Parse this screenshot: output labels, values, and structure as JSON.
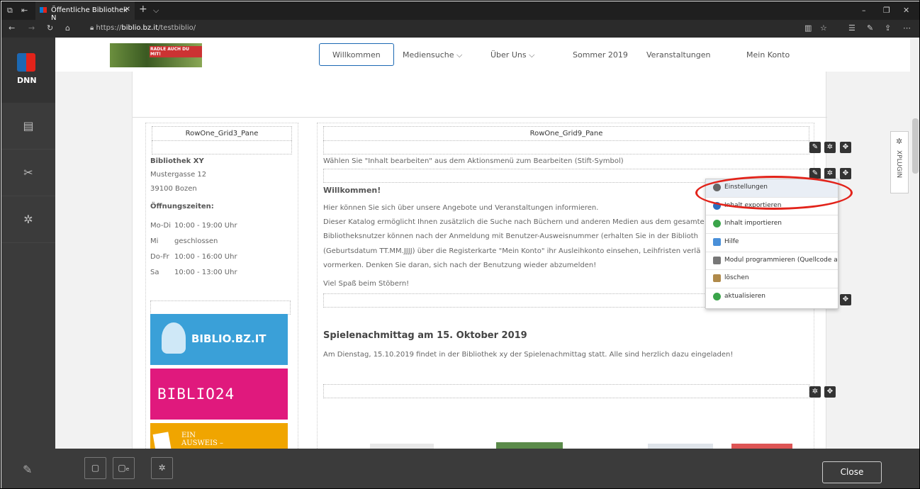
{
  "browser": {
    "tab_title": "Öffentliche Bibliothek N",
    "url_prefix": "https://",
    "url_host": "biblio.bz.it",
    "url_path": "/testbiblio/"
  },
  "dnn": {
    "logo_text": "DNN"
  },
  "nav": [
    "Willkommen",
    "Mediensuche ⌵",
    "Über Uns ⌵",
    "Sommer 2019",
    "Veranstaltungen",
    "Mein Konto"
  ],
  "banner": {
    "text": "RADLE AUCH DU MIT!"
  },
  "left": {
    "pane": "RowOne_Grid3_Pane",
    "name": "Bibliothek XY",
    "street": "Mustergasse 12",
    "city": "39100 Bozen",
    "hours_title": "Öffnungszeiten:",
    "hours": [
      [
        "Mo-Di",
        "10:00 - 19:00 Uhr"
      ],
      [
        "Mi",
        "geschlossen"
      ],
      [
        "Do-Fr",
        "10:00 - 16:00 Uhr"
      ],
      [
        "Sa",
        "10:00 - 13:00 Uhr"
      ]
    ],
    "logos": [
      "BIBLIO.BZ.IT",
      "BIBLIO24",
      "EIN AUSWEIS –"
    ]
  },
  "right": {
    "pane": "RowOne_Grid9_Pane",
    "hint": "Wählen Sie \"Inhalt bearbeiten\" aus dem Aktionsmenü zum Bearbeiten (Stift-Symbol)",
    "welcome_title": "Willkommen!",
    "lines": [
      "Hier können Sie sich über unsere Angebote und Veranstaltungen informieren.",
      "Dieser Katalog ermöglicht Ihnen zusätzlich die Suche nach Büchern und anderen Medien aus dem gesamte",
      "Bibliotheksnutzer können nach der Anmeldung mit Benutzer-Ausweisnummer (erhalten Sie in der Biblioth",
      "(Geburtsdatum TT.MM.JJJJ) über die Registerkarte \"Mein Konto\" ihr Ausleihkonto einsehen, Leihfristen verlä",
      "vormerken. Denken Sie daran, sich nach der Benutzung wieder abzumelden!"
    ],
    "fun": "Viel Spaß beim Stöbern!",
    "event_title": "Spielenachmittag am 15. Oktober 2019",
    "event_text": "Am Dienstag, 15.10.2019 findet in der Bibliothek xy der Spielenachmittag statt. Alle sind herzlich dazu eingeladen!"
  },
  "menu": [
    "Einstellungen",
    "Inhalt exportieren",
    "Inhalt importieren",
    "Hilfe",
    "Modul programmieren (Quellcode ar",
    "löschen",
    "aktualisieren"
  ],
  "side": {
    "xplugin": "XPLUGIN"
  },
  "bottom": {
    "close": "Close"
  }
}
